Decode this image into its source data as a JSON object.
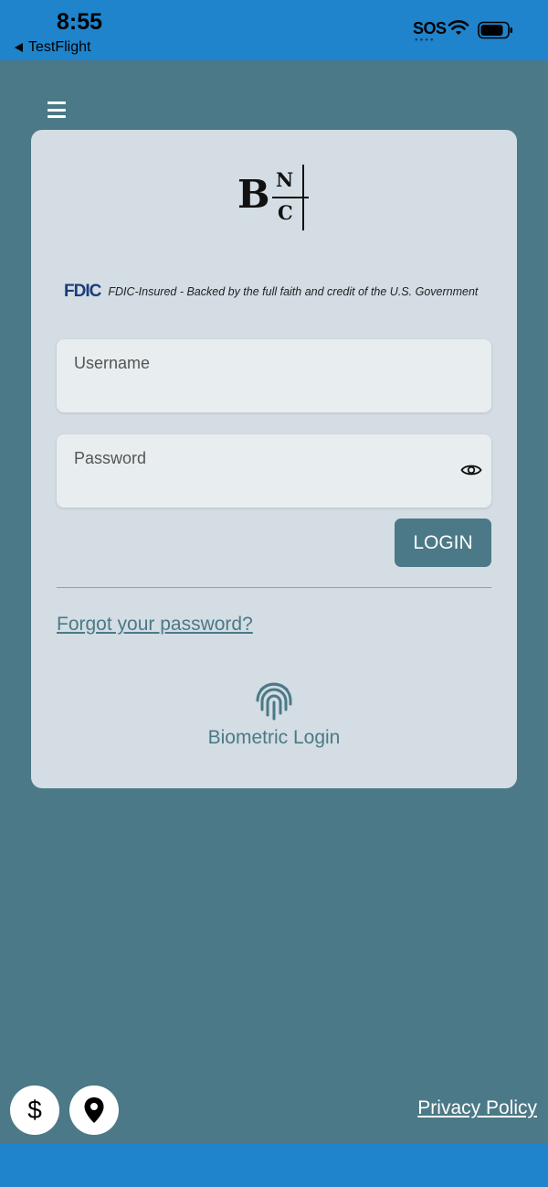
{
  "status_bar": {
    "time": "8:55",
    "back_app": "TestFlight",
    "carrier": "SOS"
  },
  "header": {
    "menu_icon": "hamburger-menu-icon"
  },
  "logo": {
    "letter_b": "B",
    "letter_n": "N",
    "letter_c": "C"
  },
  "fdic": {
    "logo_text": "FDIC",
    "notice": "FDIC-Insured - Backed by the full faith and credit of the U.S. Government"
  },
  "login_form": {
    "username_placeholder": "Username",
    "username_value": "",
    "password_placeholder": "Password",
    "password_value": "",
    "login_label": "LOGIN",
    "forgot_label": "Forgot your password?",
    "biometric_label": "Biometric Login"
  },
  "footer": {
    "dollar_label": "$",
    "privacy_label": "Privacy Policy"
  },
  "colors": {
    "background": "#4b7987",
    "status_bar": "#1f84cc",
    "card": "#d3dde3",
    "accent": "#4b7987"
  }
}
